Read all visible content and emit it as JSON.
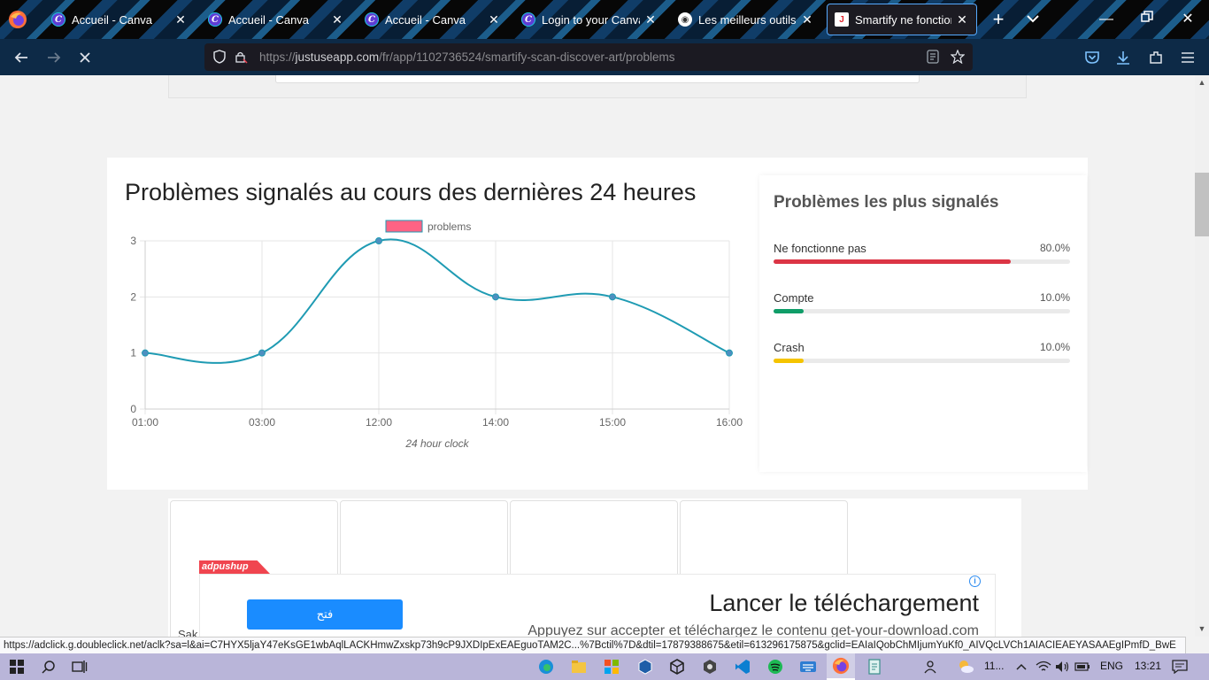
{
  "browser": {
    "tabs": [
      {
        "label": "Accueil - Canva",
        "favicon": "canva-icon",
        "active": false
      },
      {
        "label": "Accueil - Canva",
        "favicon": "canva-icon",
        "active": false
      },
      {
        "label": "Accueil - Canva",
        "favicon": "canva-icon",
        "active": false
      },
      {
        "label": "Login to your Canva ac",
        "favicon": "canva-icon",
        "active": false
      },
      {
        "label": "Les meilleurs outils dig",
        "favicon": "globe-icon",
        "active": false
      },
      {
        "label": "Smartify ne fonctionne",
        "favicon": "justuseapp-icon",
        "active": true
      }
    ],
    "url_prefix": "https://",
    "url_host": "justuseapp.com",
    "url_path": "/fr/app/1102736524/smartify-scan-discover-art/problems"
  },
  "main_card": {
    "title": "Problèmes signalés au cours des dernières 24 heures"
  },
  "chart_data": {
    "type": "line",
    "categories": [
      "01:00",
      "03:00",
      "12:00",
      "14:00",
      "15:00",
      "16:00"
    ],
    "series": [
      {
        "name": "problems",
        "values": [
          1,
          1,
          3,
          2,
          2,
          1
        ]
      }
    ],
    "xlabel": "24 hour clock",
    "ylabel": "",
    "ylim": [
      0,
      3
    ],
    "yticks": [
      "0",
      "1",
      "2",
      "3"
    ],
    "grid": true,
    "legend": "top-center",
    "colors": {
      "line": "#1f9bb3",
      "legend_swatch": "#ff6384",
      "point": "#4e8fc0"
    }
  },
  "side_panel": {
    "title": "Problèmes les plus signalés",
    "items": [
      {
        "name": "Ne fonctionne pas",
        "percent_label": "80.0%",
        "fraction": 0.8,
        "color": "#dc3545"
      },
      {
        "name": "Compte",
        "percent_label": "10.0%",
        "fraction": 0.1,
        "color": "#0f9d68"
      },
      {
        "name": "Crash",
        "percent_label": "10.0%",
        "fraction": 0.1,
        "color": "#f5c400"
      }
    ]
  },
  "ad": {
    "brand": "adpushup",
    "button_label": "فتح",
    "headline": "Lancer le téléchargement",
    "subline": "Appuyez sur accepter et téléchargez le contenu get-your-download.com",
    "info_label": "i",
    "partial_text": "Sak"
  },
  "status_link": "https://adclick.g.doubleclick.net/aclk?sa=l&ai=C7HYX5ljaY47eKsGE1wbAqlLACKHmwZxskp73h9cP9JXDIpExEAEguoTAM2C...%7Bctil%7D&dtil=17879388675&etil=613296175875&gclid=EAIaIQobChMIjumYuKf0_AIVQcLVCh1AIACIEAEYASAAEgIPmfD_BwE",
  "taskbar": {
    "weather": "11...",
    "language": "ENG",
    "time": "13:21"
  }
}
